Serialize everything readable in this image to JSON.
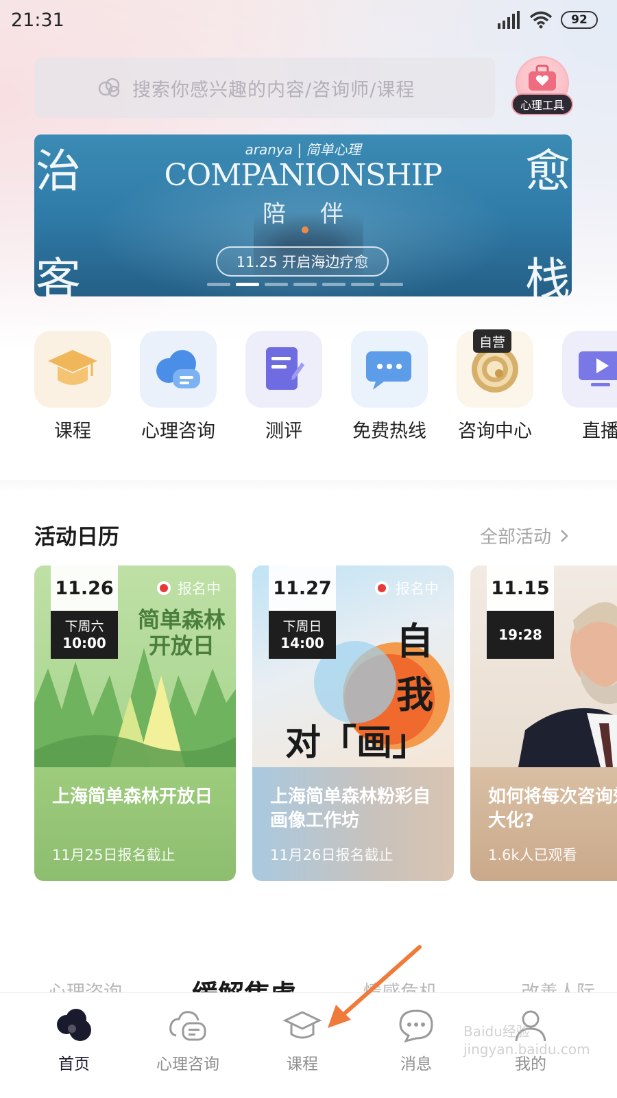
{
  "status_bar": {
    "time": "21:31",
    "battery": "92"
  },
  "search": {
    "placeholder": "搜索你感兴趣的内容/咨询师/课程"
  },
  "tool": {
    "label": "心理工具"
  },
  "banner": {
    "brand": "aranya | 简单心理",
    "title": "COMPANIONSHIP",
    "subtitle": "陪伴",
    "left_top": "治",
    "left_bottom": "客",
    "right_top": "愈",
    "right_bottom": "栈",
    "pill": "11.25 开启海边疗愈",
    "page_count": 7,
    "active_page": 2
  },
  "categories": [
    {
      "label": "课程",
      "icon": "graduation-cap-icon"
    },
    {
      "label": "心理咨询",
      "icon": "cloud-chat-icon"
    },
    {
      "label": "测评",
      "icon": "document-pen-icon"
    },
    {
      "label": "免费热线",
      "icon": "chat-bubble-icon"
    },
    {
      "label": "咨询中心",
      "icon": "target-icon",
      "badge": "自营"
    },
    {
      "label": "直播",
      "icon": "video-play-icon"
    }
  ],
  "activity": {
    "title": "活动日历",
    "all_label": "全部活动",
    "cards": [
      {
        "date": "11.26",
        "weekday": "下周六",
        "time": "10:00",
        "status": "报名中",
        "art_text": "简单森林 开放日",
        "name": "上海简单森林开放日",
        "meta": "11月25日报名截止"
      },
      {
        "date": "11.27",
        "weekday": "下周日",
        "time": "14:00",
        "status": "报名中",
        "art_text_1": "自",
        "art_text_2": "我",
        "art_text_3": "对「画」",
        "name": "上海简单森林粉彩自画像工作坊",
        "meta": "11月26日报名截止"
      },
      {
        "date": "11.15",
        "time": "19:28",
        "name": "如何将每次咨询效果最大化?",
        "meta": "1.6k人已观看"
      }
    ]
  },
  "peek_tabs": [
    "心理咨询",
    "缓解焦虑",
    "情感危机",
    "改善人际"
  ],
  "bottom_nav": [
    {
      "label": "首页",
      "icon": "home-icon",
      "active": true
    },
    {
      "label": "心理咨询",
      "icon": "cloud-chat-icon"
    },
    {
      "label": "课程",
      "icon": "graduation-cap-icon"
    },
    {
      "label": "消息",
      "icon": "message-icon"
    },
    {
      "label": "我的",
      "icon": "profile-icon"
    }
  ],
  "watermark": "Baidu经验 jingyan.baidu.com",
  "colors": {
    "accent_dark": "#1a1a2e",
    "signup_red": "#e63a3a",
    "arrow_orange": "#f07a3a",
    "banner_blue": "#2f7ba8"
  }
}
